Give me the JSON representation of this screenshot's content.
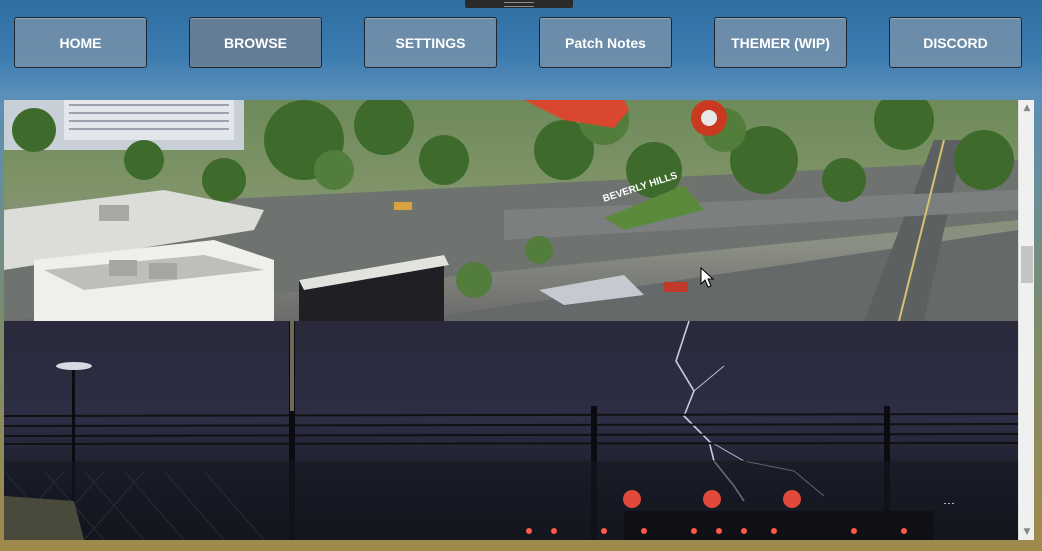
{
  "nav": {
    "home": "HOME",
    "browse": "BROWSE",
    "settings": "SETTINGS",
    "patch_notes": "Patch Notes",
    "themer": "THEMER (WIP)",
    "discord": "DISCORD"
  },
  "scene": {
    "sign_text": "BEVERLY HILLS"
  },
  "colors": {
    "button_bg": "#7891aa",
    "button_border": "#1e2630",
    "scrollbar_bg": "#f0f0f0",
    "scroll_thumb": "#c4c4c4"
  },
  "icons": {
    "scroll_up": "arrow-up-icon",
    "scroll_down": "arrow-down-icon",
    "cursor": "mouse-pointer-icon"
  },
  "scroll": {
    "position": 0.35
  }
}
